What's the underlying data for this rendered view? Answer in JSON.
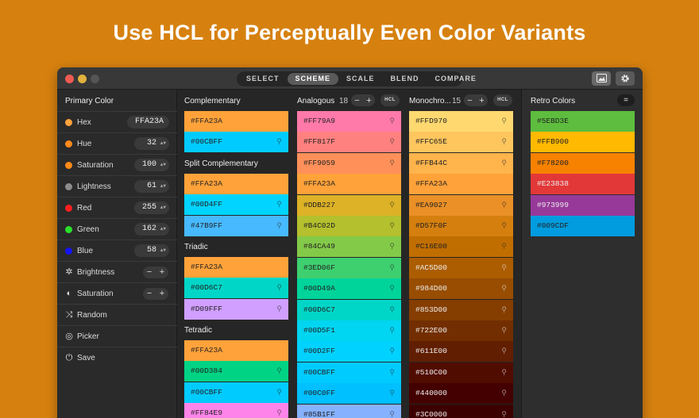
{
  "headline": "Use HCL for Perceptually Even Color Variants",
  "toolbar": {
    "tabs": [
      "SELECT",
      "SCHEME",
      "SCALE",
      "BLEND",
      "COMPARE"
    ],
    "active_tab": "SCHEME",
    "image_icon": "image-icon",
    "gear_icon": "gear-icon"
  },
  "sidebar": {
    "title": "Primary Color",
    "hex": {
      "label": "Hex",
      "value": "FFA23A",
      "color": "#FFA23A"
    },
    "channels": [
      {
        "label": "Hue",
        "value": "32",
        "color": "#FF8A1A"
      },
      {
        "label": "Saturation",
        "value": "100",
        "color": "#FF8A1A"
      },
      {
        "label": "Lightness",
        "value": "61",
        "color": "#8C8C8C"
      },
      {
        "label": "Red",
        "value": "255",
        "color": "#FF1F1F"
      },
      {
        "label": "Green",
        "value": "162",
        "color": "#2BE02B"
      },
      {
        "label": "Blue",
        "value": "58",
        "color": "#1414F0"
      }
    ],
    "adjust": [
      {
        "label": "Brightness",
        "icon": "brightness-icon",
        "minus": "−",
        "plus": "+"
      },
      {
        "label": "Saturation",
        "icon": "contrast-icon",
        "minus": "−",
        "plus": "+"
      }
    ],
    "actions": [
      {
        "label": "Random",
        "icon": "shuffle-icon"
      },
      {
        "label": "Picker",
        "icon": "picker-icon"
      },
      {
        "label": "Save",
        "icon": "power-icon"
      }
    ]
  },
  "schemes": {
    "complementary": {
      "title": "Complementary",
      "colors": [
        {
          "hex": "#FFA23A"
        },
        {
          "hex": "#00CBFF"
        }
      ]
    },
    "split": {
      "title": "Split Complementary",
      "colors": [
        {
          "hex": "#FFA23A"
        },
        {
          "hex": "#00D4FF"
        },
        {
          "hex": "#47B9FF"
        }
      ]
    },
    "triadic": {
      "title": "Triadic",
      "colors": [
        {
          "hex": "#FFA23A"
        },
        {
          "hex": "#00D6C7"
        },
        {
          "hex": "#D09FFF"
        }
      ]
    },
    "tetradic": {
      "title": "Tetradic",
      "colors": [
        {
          "hex": "#FFA23A"
        },
        {
          "hex": "#00D384"
        },
        {
          "hex": "#00CBFF"
        },
        {
          "hex": "#FF84E9"
        }
      ]
    }
  },
  "analogous": {
    "title": "Analogous",
    "count": "18",
    "minus": "−",
    "plus": "+",
    "mode": "HCL",
    "colors": [
      "#FF79A9",
      "#FF817F",
      "#FF9059",
      "#FFA23A",
      "#DDB227",
      "#B4C02D",
      "#84CA49",
      "#3ED06F",
      "#00D49A",
      "#00D6C7",
      "#00D5F1",
      "#00D2FF",
      "#00CBFF",
      "#00C0FF",
      "#85B1FF"
    ]
  },
  "monochromatic": {
    "title": "Monochro...",
    "count": "15",
    "minus": "−",
    "plus": "+",
    "mode": "HCL",
    "colors": [
      "#FFD970",
      "#FFC65E",
      "#FFB44C",
      "#FFA23A",
      "#EA9027",
      "#D57F0F",
      "#C16E00",
      "#AC5D00",
      "#984D00",
      "#853D00",
      "#722E00",
      "#611E00",
      "#510C00",
      "#440000",
      "#3C0000"
    ]
  },
  "retro": {
    "title": "Retro Colors",
    "menu": "=",
    "colors": [
      "#5EBD3E",
      "#FFB900",
      "#F78200",
      "#E23838",
      "#973999",
      "#009CDF"
    ]
  }
}
